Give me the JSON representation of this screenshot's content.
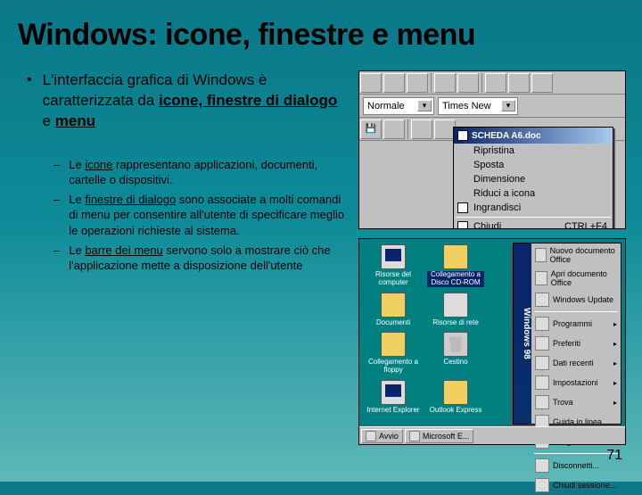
{
  "title": "Windows: icone, finestre e menu",
  "main": {
    "prefix": "L'interfaccia ",
    "word_grafica": "grafica",
    "mid1": " di Windows è caratterizzata da ",
    "kw1": "icone, finestre di dialogo",
    "mid2": " e ",
    "kw2": "menu"
  },
  "subs": [
    {
      "pre": "Le ",
      "kw": "icone",
      "post": " rappresentano applicazioni, documenti, cartelle o dispositivi."
    },
    {
      "pre": "Le ",
      "kw": "finestre di dialogo",
      "post": " sono associate a molti comandi di menu per consentire all'utente di specificare meglio le operazioni richieste al sistema."
    },
    {
      "pre": "Le ",
      "kw": "barre dei menu",
      "post": " servono solo a mostrare ciò che l'applicazione mette a disposizione dell'utente"
    }
  ],
  "toolbar": {
    "drop1": "Normale",
    "drop2": "Times New"
  },
  "ctxmenu": {
    "title": "SCHEDA A6.doc",
    "items": [
      {
        "label": "Ripristina"
      },
      {
        "label": "Sposta"
      },
      {
        "label": "Dimensione"
      },
      {
        "label": "Riduci a icona"
      },
      {
        "label": "Ingrandisci"
      },
      {
        "label": "Chiudi",
        "shortcut": "CTRL+F4"
      }
    ]
  },
  "desktop": {
    "icons": [
      {
        "label": "Risorse del\ncomputer",
        "cls": "monitor"
      },
      {
        "label": "Collegamento a\nDisco CD-ROM",
        "cls": "folder",
        "sel": true
      },
      {
        "label": "",
        "cls": ""
      },
      {
        "label": "Documenti",
        "cls": "folder"
      },
      {
        "label": "Risorse di rete",
        "cls": "net"
      },
      {
        "label": "",
        "cls": ""
      },
      {
        "label": "Collegamento a\nfloppy",
        "cls": "folder"
      },
      {
        "label": "Cestino",
        "cls": "bin"
      },
      {
        "label": "",
        "cls": ""
      },
      {
        "label": "Internet\nExplorer",
        "cls": "monitor"
      },
      {
        "label": "Outlook Express",
        "cls": "folder"
      }
    ]
  },
  "startmenu": {
    "stripe": "Windows 98",
    "items": [
      {
        "label": "Nuovo documento Office"
      },
      {
        "label": "Apri documento Office"
      },
      {
        "label": "Windows Update"
      },
      {
        "sep": true
      },
      {
        "label": "Programmi",
        "arrow": true
      },
      {
        "label": "Preferiti",
        "arrow": true
      },
      {
        "label": "Dati recenti",
        "arrow": true
      },
      {
        "label": "Impostazioni",
        "arrow": true
      },
      {
        "label": "Trova",
        "arrow": true
      },
      {
        "label": "Guida in linea"
      },
      {
        "label": "Esegui..."
      },
      {
        "sep": true
      },
      {
        "label": "Disconnetti..."
      },
      {
        "label": "Chiudi sessione..."
      }
    ]
  },
  "taskbar": {
    "btn1": "Avvio",
    "btn2": "Microsoft E..."
  },
  "page": "71"
}
